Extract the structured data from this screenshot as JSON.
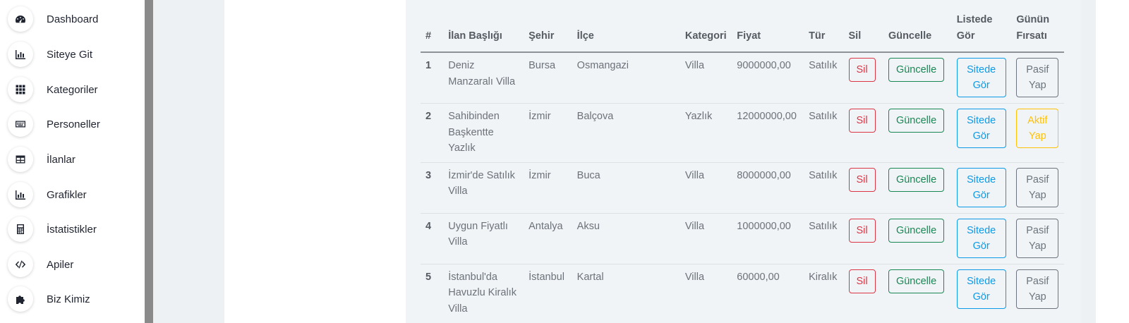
{
  "sidebar": {
    "items": [
      {
        "label": "Dashboard",
        "icon": "gauge-icon"
      },
      {
        "label": "Siteye Git",
        "icon": "chart-icon"
      },
      {
        "label": "Kategoriler",
        "icon": "grid-icon"
      },
      {
        "label": "Personeller",
        "icon": "keyboard-icon"
      },
      {
        "label": "İlanlar",
        "icon": "table-icon"
      },
      {
        "label": "Grafikler",
        "icon": "chart-icon"
      },
      {
        "label": "İstatistikler",
        "icon": "calculator-icon"
      },
      {
        "label": "Apiler",
        "icon": "code-icon"
      },
      {
        "label": "Biz Kimiz",
        "icon": "puzzle-icon"
      }
    ]
  },
  "table": {
    "headers": {
      "num": "#",
      "title": "İlan Başlığı",
      "city": "Şehir",
      "district": "İlçe",
      "category": "Kategori",
      "price": "Fiyat",
      "type": "Tür",
      "delete": "Sil",
      "update": "Güncelle",
      "view": "Listede Gör",
      "deal": "Günün Fırsatı"
    },
    "rows": [
      {
        "num": "1",
        "title": "Deniz Manzaralı Villa",
        "city": "Bursa",
        "district": "Osmangazi",
        "category": "Villa",
        "price": "9000000,00",
        "type": "Satılık",
        "delete_label": "Sil",
        "update_label": "Güncelle",
        "view_label": "Sitede Gör",
        "deal_label": "Pasif Yap",
        "deal_state": "passive"
      },
      {
        "num": "2",
        "title": "Sahibinden Başkentte Yazlık",
        "city": "İzmir",
        "district": "Balçova",
        "category": "Yazlık",
        "price": "12000000,00",
        "type": "Satılık",
        "delete_label": "Sil",
        "update_label": "Güncelle",
        "view_label": "Sitede Gör",
        "deal_label": "Aktif Yap",
        "deal_state": "active"
      },
      {
        "num": "3",
        "title": "İzmir'de Satılık Villa",
        "city": "İzmir",
        "district": "Buca",
        "category": "Villa",
        "price": "8000000,00",
        "type": "Satılık",
        "delete_label": "Sil",
        "update_label": "Güncelle",
        "view_label": "Sitede Gör",
        "deal_label": "Pasif Yap",
        "deal_state": "passive"
      },
      {
        "num": "4",
        "title": "Uygun Fiyatlı Villa",
        "city": "Antalya",
        "district": "Aksu",
        "category": "Villa",
        "price": "1000000,00",
        "type": "Satılık",
        "delete_label": "Sil",
        "update_label": "Güncelle",
        "view_label": "Sitede Gör",
        "deal_label": "Pasif Yap",
        "deal_state": "passive"
      },
      {
        "num": "5",
        "title": "İstanbul'da Havuzlu Kiralık Villa",
        "city": "İstanbul",
        "district": "Kartal",
        "category": "Villa",
        "price": "60000,00",
        "type": "Kiralık",
        "delete_label": "Sil",
        "update_label": "Güncelle",
        "view_label": "Sitede Gör",
        "deal_label": "Pasif Yap",
        "deal_state": "passive"
      }
    ]
  },
  "colors": {
    "danger": "#dc3545",
    "success": "#198754",
    "info": "#0d9ae8",
    "secondary": "#6c757d",
    "warning": "#ffc107"
  }
}
